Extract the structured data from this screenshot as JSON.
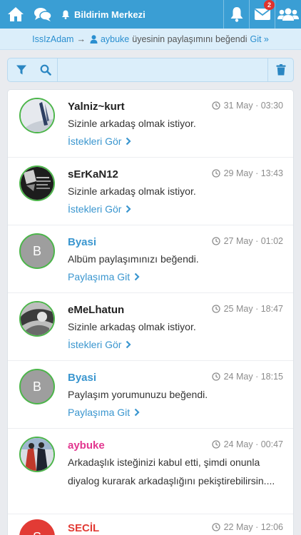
{
  "header": {
    "title": "Bildirim Merkezi",
    "mail_badge": "2",
    "icons": [
      "home-icon",
      "chat-icon",
      "bell-icon",
      "bell-icon",
      "mail-icon",
      "users-icon"
    ]
  },
  "activity": {
    "actor": "IssIzAdam",
    "arrow": "→",
    "target": "aybuke",
    "text": "üyesinin paylaşımını beğendi",
    "link": "Git »"
  },
  "filter": {
    "search_placeholder": "",
    "search_value": ""
  },
  "notifications": [
    {
      "name": "Yalniz~kurt",
      "name_color": "dark",
      "time": "31 May · 03:30",
      "message": "Sizinle arkadaş olmak istiyor.",
      "action": "İstekleri Gör",
      "avatar": "photo"
    },
    {
      "name": "sErKaN12",
      "name_color": "dark",
      "time": "29 May · 13:43",
      "message": "Sizinle arkadaş olmak istiyor.",
      "action": "İstekleri Gör",
      "avatar": "photo"
    },
    {
      "name": "Byasi",
      "name_color": "blue",
      "time": "27 May · 01:02",
      "message": "Albüm paylaşımınızı beğendi.",
      "action": "Paylaşıma Git",
      "avatar": "B"
    },
    {
      "name": "eMeLhatun",
      "name_color": "dark",
      "time": "25 May · 18:47",
      "message": "Sizinle arkadaş olmak istiyor.",
      "action": "İstekleri Gör",
      "avatar": "photo"
    },
    {
      "name": "Byasi",
      "name_color": "blue",
      "time": "24 May · 18:15",
      "message": "Paylaşım yorumunuzu beğendi.",
      "action": "Paylaşıma Git",
      "avatar": "B"
    },
    {
      "name": "aybuke",
      "name_color": "pink",
      "time": "24 May · 00:47",
      "message": "Arkadaşlık isteğinizi kabul etti, şimdi onunla diyalog kurarak arkadaşlığını pekiştirebilirsin....",
      "action": "",
      "avatar": "photo"
    },
    {
      "name": "SECİL",
      "name_color": "red",
      "time": "22 May · 12:06",
      "message": "",
      "action": "",
      "avatar": "S"
    }
  ],
  "colors": {
    "topbar": "#3a9ed4",
    "online_ring": "#4cb54a",
    "link_blue": "#3a96cf",
    "badge_red": "#e0332e"
  }
}
